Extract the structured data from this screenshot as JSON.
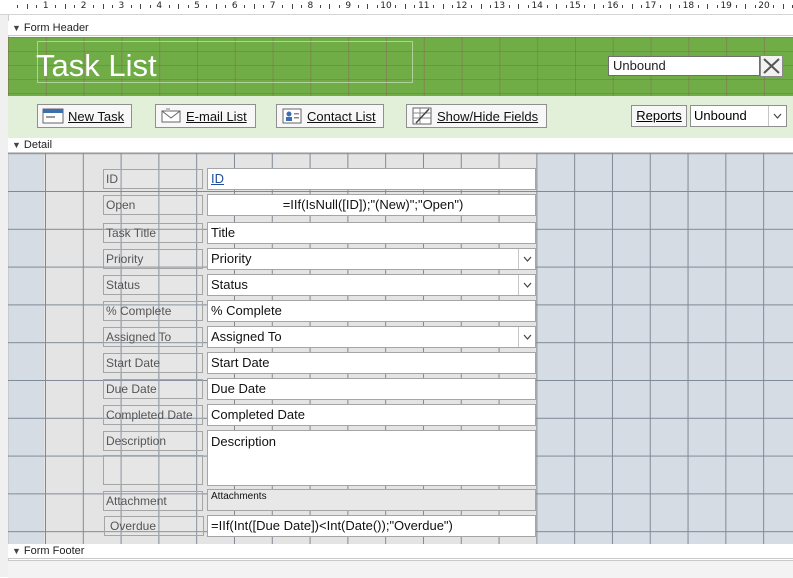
{
  "ruler": {
    "numbers": [
      "1",
      "2",
      "3",
      "4",
      "5",
      "6",
      "7",
      "8",
      "9",
      "10",
      "11",
      "12",
      "13",
      "14",
      "15",
      "16",
      "17",
      "18",
      "19",
      "20"
    ]
  },
  "sections": {
    "header": "Form Header",
    "detail": "Detail",
    "footer": "Form Footer"
  },
  "header": {
    "title": "Task List",
    "search_value": "Unbound"
  },
  "toolbar": {
    "new_task": "New Task",
    "email_list": "E-mail List",
    "contact_list": "Contact List",
    "show_hide_fields": "Show/Hide Fields",
    "reports": "Reports",
    "reports_combo": "Unbound"
  },
  "fields": [
    {
      "label": "ID",
      "value": "ID"
    },
    {
      "label": "Open",
      "value": "=IIf(IsNull([ID]);\"(New)\";\"Open\")"
    },
    {
      "label": "Task Title",
      "value": "Title"
    },
    {
      "label": "Priority",
      "value": "Priority"
    },
    {
      "label": "Status",
      "value": "Status"
    },
    {
      "label": "% Complete",
      "value": "% Complete"
    },
    {
      "label": "Assigned To",
      "value": "Assigned To"
    },
    {
      "label": "Start Date",
      "value": "Start Date"
    },
    {
      "label": "Due Date",
      "value": "Due Date"
    },
    {
      "label": "Completed Date",
      "value": "Completed Date"
    },
    {
      "label": "Description",
      "value": "Description"
    },
    {
      "label": "Attachment",
      "value": "Attachments"
    },
    {
      "label": "Overdue",
      "value": "=IIf(Int([Due Date])<Int(Date());\"Overdue\")"
    }
  ],
  "colors": {
    "header_green": "#70ad47",
    "toolbar_green": "#e2efd9",
    "grid_bg": "#d6dce4"
  },
  "icons": [
    "new-task-icon",
    "email-list-icon",
    "contact-list-icon",
    "show-hide-fields-icon",
    "close-icon",
    "chevron-down-icon"
  ]
}
